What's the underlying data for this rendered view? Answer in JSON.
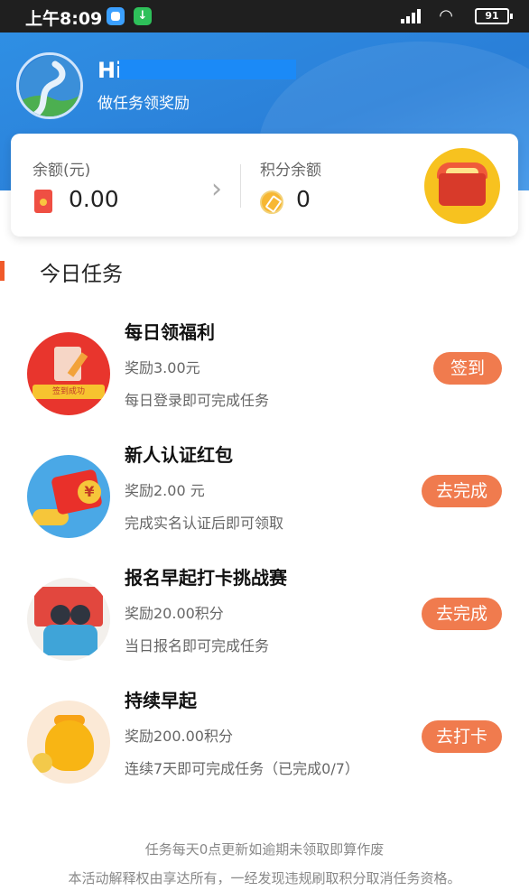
{
  "status_bar": {
    "time": "上午8:09",
    "battery": "91"
  },
  "header": {
    "greeting": "Hi",
    "subtitle": "做任务领奖励"
  },
  "balance": {
    "cash_label": "余额(元)",
    "cash_value": "0.00",
    "points_label": "积分余额",
    "points_value": "0"
  },
  "section": {
    "title": "今日任务"
  },
  "tasks": [
    {
      "title": "每日领福利",
      "reward": "奖励3.00元",
      "desc": "每日登录即可完成任务",
      "button": "签到",
      "icon": "checkin-icon"
    },
    {
      "title": "新人认证红包",
      "reward": "奖励2.00 元",
      "desc": "完成实名认证后即可领取",
      "button": "去完成",
      "icon": "red-envelope-icon"
    },
    {
      "title": "报名早起打卡挑战赛",
      "reward": "奖励20.00积分",
      "desc": "当日报名即可完成任务",
      "button": "去完成",
      "icon": "morning-challenge-icon"
    },
    {
      "title": "持续早起",
      "reward": "奖励200.00积分",
      "desc": "连续7天即可完成任务（已完成0/7）",
      "button": "去打卡",
      "icon": "gold-bag-icon"
    }
  ],
  "icon_labels": {
    "checkin_banner": "签到成功",
    "yen": "¥"
  },
  "footer": {
    "line1": "任务每天0点更新如逾期未领取即算作废",
    "line2": "本活动解释权由享达所有，一经发现违规刷取积分取消任务资格。"
  },
  "colors": {
    "header_blue": "#2a7fd8",
    "button_orange": "#f07b4e",
    "section_accent": "#f05a2a"
  }
}
